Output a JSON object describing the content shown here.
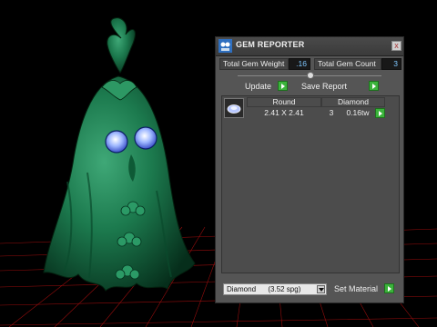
{
  "window": {
    "title": "GEM REPORTER",
    "close_symbol": "x"
  },
  "summary": {
    "weight_label": "Total Gem Weight",
    "weight_value": ".16",
    "count_label": "Total Gem Count",
    "count_value": "3"
  },
  "actions": {
    "update_label": "Update",
    "save_report_label": "Save Report"
  },
  "table": {
    "col_shape": "Round",
    "col_material": "Diamond",
    "row": {
      "size": "2.41 X 2.41",
      "count": "3",
      "weight": "0.16tw"
    }
  },
  "material": {
    "selected": "Diamond      (3.52 spg)",
    "set_label": "Set Material"
  },
  "colors": {
    "accent": "#3bb33b",
    "value_text": "#7ec6ff",
    "model": "#1c7a4e"
  }
}
